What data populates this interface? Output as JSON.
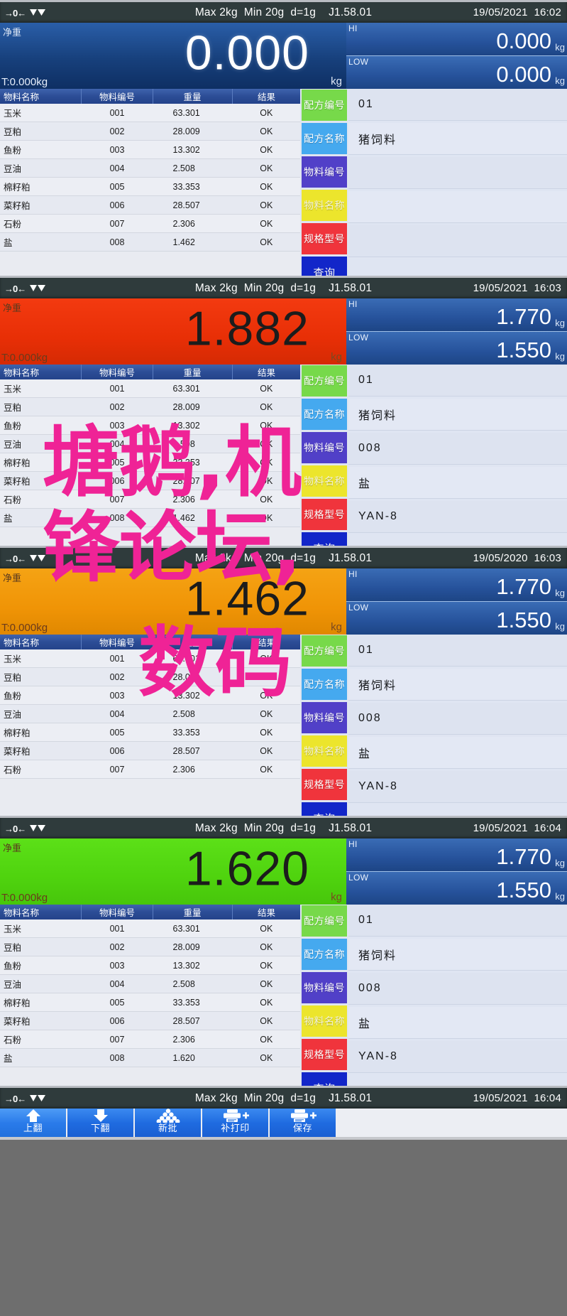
{
  "device": {
    "status_bar": {
      "zero_icon": "zero-indicator-icon",
      "stable_icon": "stable-indicator-icon",
      "spec": "Max 2kg  Min 20g  d=1g    J1.58.01"
    },
    "labels": {
      "net": "净重",
      "hi": "HI",
      "low": "LOW",
      "kg": "kg"
    },
    "table_headers": {
      "name": "物料名称",
      "code": "物料编号",
      "weight": "重量",
      "result": "结果"
    },
    "side_buttons": [
      {
        "key": "formula_no",
        "label": "配方编号",
        "color": "#77d94a"
      },
      {
        "key": "formula_name",
        "label": "配方名称",
        "color": "#45a9ef"
      },
      {
        "key": "material_no",
        "label": "物料编号",
        "color": "#5140c8"
      },
      {
        "key": "material_name",
        "label": "物料名称",
        "color": "#ece52c"
      },
      {
        "key": "spec_model",
        "label": "规格型号",
        "color": "#f0343c"
      },
      {
        "key": "query",
        "label": "查询",
        "color": "#1226c9"
      }
    ],
    "toolbar": [
      {
        "key": "page_up",
        "label": "上翻",
        "icon": "arrow-up-icon"
      },
      {
        "key": "page_down",
        "label": "下翻",
        "icon": "arrow-down-icon"
      },
      {
        "key": "new_batch",
        "label": "新批",
        "icon": "stack-pile-icon"
      },
      {
        "key": "reprint",
        "label": "补打印",
        "icon": "printer-plus-icon"
      },
      {
        "key": "save",
        "label": "保存",
        "icon": "printer-plus-icon"
      }
    ]
  },
  "panels": [
    {
      "id": "panel-1",
      "datetime": "19/05/2021  16:02",
      "weight": "0.000",
      "weight_color": "blue",
      "tare": "T:0.000kg",
      "hi": "0.000",
      "low": "0.000",
      "rows": [
        {
          "name": "玉米",
          "code": "001",
          "weight": "63.301",
          "result": "OK"
        },
        {
          "name": "豆粕",
          "code": "002",
          "weight": "28.009",
          "result": "OK"
        },
        {
          "name": "鱼粉",
          "code": "003",
          "weight": "13.302",
          "result": "OK"
        },
        {
          "name": "豆油",
          "code": "004",
          "weight": "2.508",
          "result": "OK"
        },
        {
          "name": "棉籽粕",
          "code": "005",
          "weight": "33.353",
          "result": "OK"
        },
        {
          "name": "菜籽粕",
          "code": "006",
          "weight": "28.507",
          "result": "OK"
        },
        {
          "name": "石粉",
          "code": "007",
          "weight": "2.306",
          "result": "OK"
        },
        {
          "name": "盐",
          "code": "008",
          "weight": "1.462",
          "result": "OK"
        }
      ],
      "side_values": [
        "01",
        "猪饲料",
        "",
        "",
        "",
        ""
      ]
    },
    {
      "id": "panel-2",
      "datetime": "19/05/2021  16:03",
      "weight": "1.882",
      "weight_color": "red",
      "tare": "T:0.000kg",
      "hi": "1.770",
      "low": "1.550",
      "rows": [
        {
          "name": "玉米",
          "code": "001",
          "weight": "63.301",
          "result": "OK"
        },
        {
          "name": "豆粕",
          "code": "002",
          "weight": "28.009",
          "result": "OK"
        },
        {
          "name": "鱼粉",
          "code": "003",
          "weight": "13.302",
          "result": "OK"
        },
        {
          "name": "豆油",
          "code": "004",
          "weight": "2.508",
          "result": "OK"
        },
        {
          "name": "棉籽粕",
          "code": "005",
          "weight": "33.353",
          "result": "OK"
        },
        {
          "name": "菜籽粕",
          "code": "006",
          "weight": "28.507",
          "result": "OK"
        },
        {
          "name": "石粉",
          "code": "007",
          "weight": "2.306",
          "result": "OK"
        },
        {
          "name": "盐",
          "code": "008",
          "weight": "1.462",
          "result": "OK"
        }
      ],
      "side_values": [
        "01",
        "猪饲料",
        "008",
        "盐",
        "YAN-8",
        ""
      ]
    },
    {
      "id": "panel-3",
      "datetime": "19/05/2020  16:03",
      "weight": "1.462",
      "weight_color": "orange",
      "tare": "T:0.000kg",
      "hi": "1.770",
      "low": "1.550",
      "rows": [
        {
          "name": "玉米",
          "code": "001",
          "weight": "63.301",
          "result": "OK"
        },
        {
          "name": "豆粕",
          "code": "002",
          "weight": "28.009",
          "result": "OK"
        },
        {
          "name": "鱼粉",
          "code": "003",
          "weight": "13.302",
          "result": "OK"
        },
        {
          "name": "豆油",
          "code": "004",
          "weight": "2.508",
          "result": "OK"
        },
        {
          "name": "棉籽粕",
          "code": "005",
          "weight": "33.353",
          "result": "OK"
        },
        {
          "name": "菜籽粕",
          "code": "006",
          "weight": "28.507",
          "result": "OK"
        },
        {
          "name": "石粉",
          "code": "007",
          "weight": "2.306",
          "result": "OK"
        }
      ],
      "side_values": [
        "01",
        "猪饲料",
        "008",
        "盐",
        "YAN-8",
        ""
      ]
    },
    {
      "id": "panel-4",
      "datetime": "19/05/2021  16:04",
      "weight": "1.620",
      "weight_color": "green",
      "tare": "T:0.000kg",
      "hi": "1.770",
      "low": "1.550",
      "rows": [
        {
          "name": "玉米",
          "code": "001",
          "weight": "63.301",
          "result": "OK"
        },
        {
          "name": "豆粕",
          "code": "002",
          "weight": "28.009",
          "result": "OK"
        },
        {
          "name": "鱼粉",
          "code": "003",
          "weight": "13.302",
          "result": "OK"
        },
        {
          "name": "豆油",
          "code": "004",
          "weight": "2.508",
          "result": "OK"
        },
        {
          "name": "棉籽粕",
          "code": "005",
          "weight": "33.353",
          "result": "OK"
        },
        {
          "name": "菜籽粕",
          "code": "006",
          "weight": "28.507",
          "result": "OK"
        },
        {
          "name": "石粉",
          "code": "007",
          "weight": "2.306",
          "result": "OK"
        },
        {
          "name": "盐",
          "code": "008",
          "weight": "1.620",
          "result": "OK"
        }
      ],
      "side_values": [
        "01",
        "猪饲料",
        "008",
        "盐",
        "YAN-8",
        ""
      ]
    },
    {
      "id": "panel-5",
      "datetime": "19/05/2021  16:04",
      "partial": true,
      "weight": "",
      "weight_color": "blue",
      "tare": "",
      "hi": "",
      "low": "",
      "rows": [],
      "side_values": []
    }
  ],
  "watermark": {
    "color": "#ef2396",
    "line1": "塘鹅,机",
    "line2": "锋论坛,",
    "line3": "数码"
  }
}
